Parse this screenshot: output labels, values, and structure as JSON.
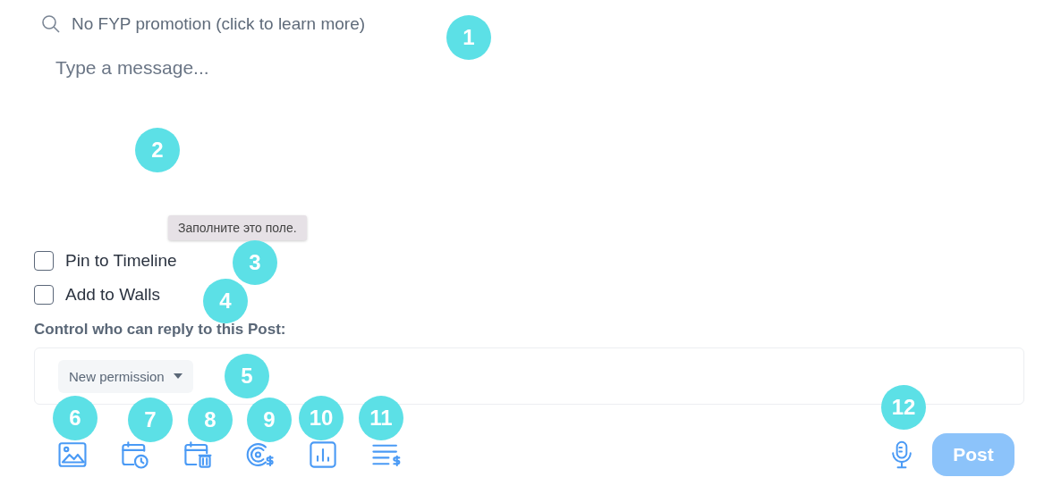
{
  "promotion": {
    "label": "No FYP promotion (click to learn more)"
  },
  "message": {
    "placeholder": "Type a message..."
  },
  "tooltip": "Заполните это поле.",
  "options": [
    {
      "label": "Pin to Timeline",
      "checked": false
    },
    {
      "label": "Add to Walls",
      "checked": false
    }
  ],
  "reply_control": {
    "label": "Control who can reply to this Post:",
    "permission": "New permission"
  },
  "toolbar": [
    {
      "kind": "image"
    },
    {
      "kind": "schedule"
    },
    {
      "kind": "delete-schedule"
    },
    {
      "kind": "tip"
    },
    {
      "kind": "poll"
    },
    {
      "kind": "paid"
    }
  ],
  "post_button": "Post",
  "callouts": [
    "1",
    "2",
    "3",
    "4",
    "5",
    "6",
    "7",
    "8",
    "9",
    "10",
    "11",
    "12"
  ]
}
